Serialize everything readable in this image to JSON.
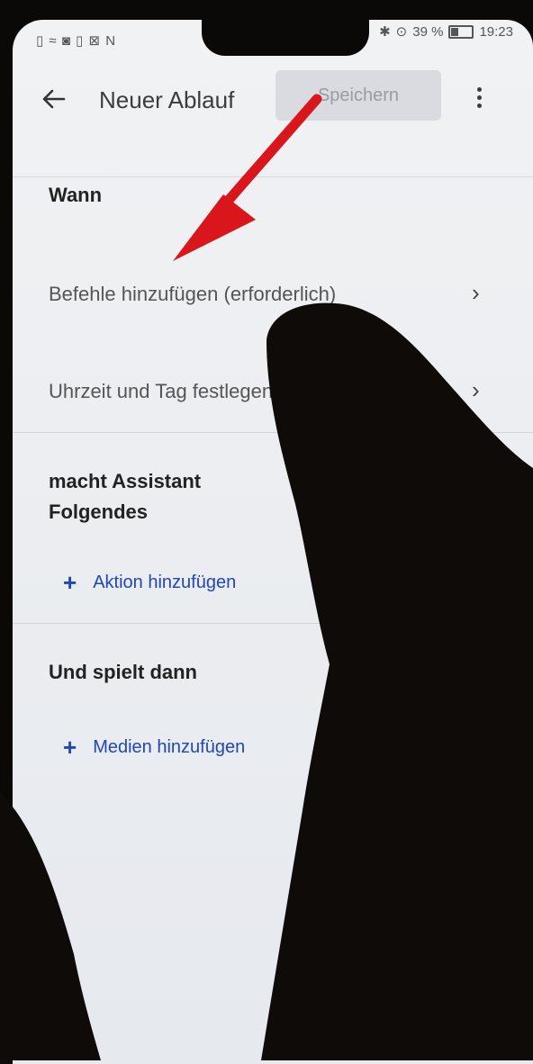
{
  "status_bar": {
    "left_icons": [
      "sim-icon",
      "signal-icon",
      "nfc-icon",
      "sim2-icon",
      "mail-icon",
      "notification-icon"
    ],
    "left_glyphs": "▯ ≈ ◙ ▯ ⊠ N",
    "bluetooth": "✱",
    "location": "⊙",
    "battery_percent": "39 %",
    "battery_level": 0.39,
    "time": "19:23"
  },
  "app_bar": {
    "back_icon": "arrow-left-icon",
    "title": "Neuer Ablauf",
    "save_label": "Speichern",
    "more_icon": "more-vertical-icon"
  },
  "when_section": {
    "heading": "Wann",
    "items": [
      {
        "label": "Befehle hinzufügen (erforderlich)",
        "chevron": "›"
      },
      {
        "label": "Uhrzeit und Tag festlegen",
        "chevron": "›"
      }
    ]
  },
  "actions_section": {
    "heading_line1": "macht Assistant",
    "heading_line2": "Folgendes",
    "add_label": "Aktion hinzufügen",
    "add_icon": "plus-icon"
  },
  "media_section": {
    "heading": "Und spielt dann",
    "add_label": "Medien hinzufügen",
    "add_icon": "plus-icon"
  },
  "colors": {
    "link_blue": "#2146b8",
    "annotation_arrow": "#d8161c",
    "save_disabled_bg": "#d9dbe0"
  }
}
